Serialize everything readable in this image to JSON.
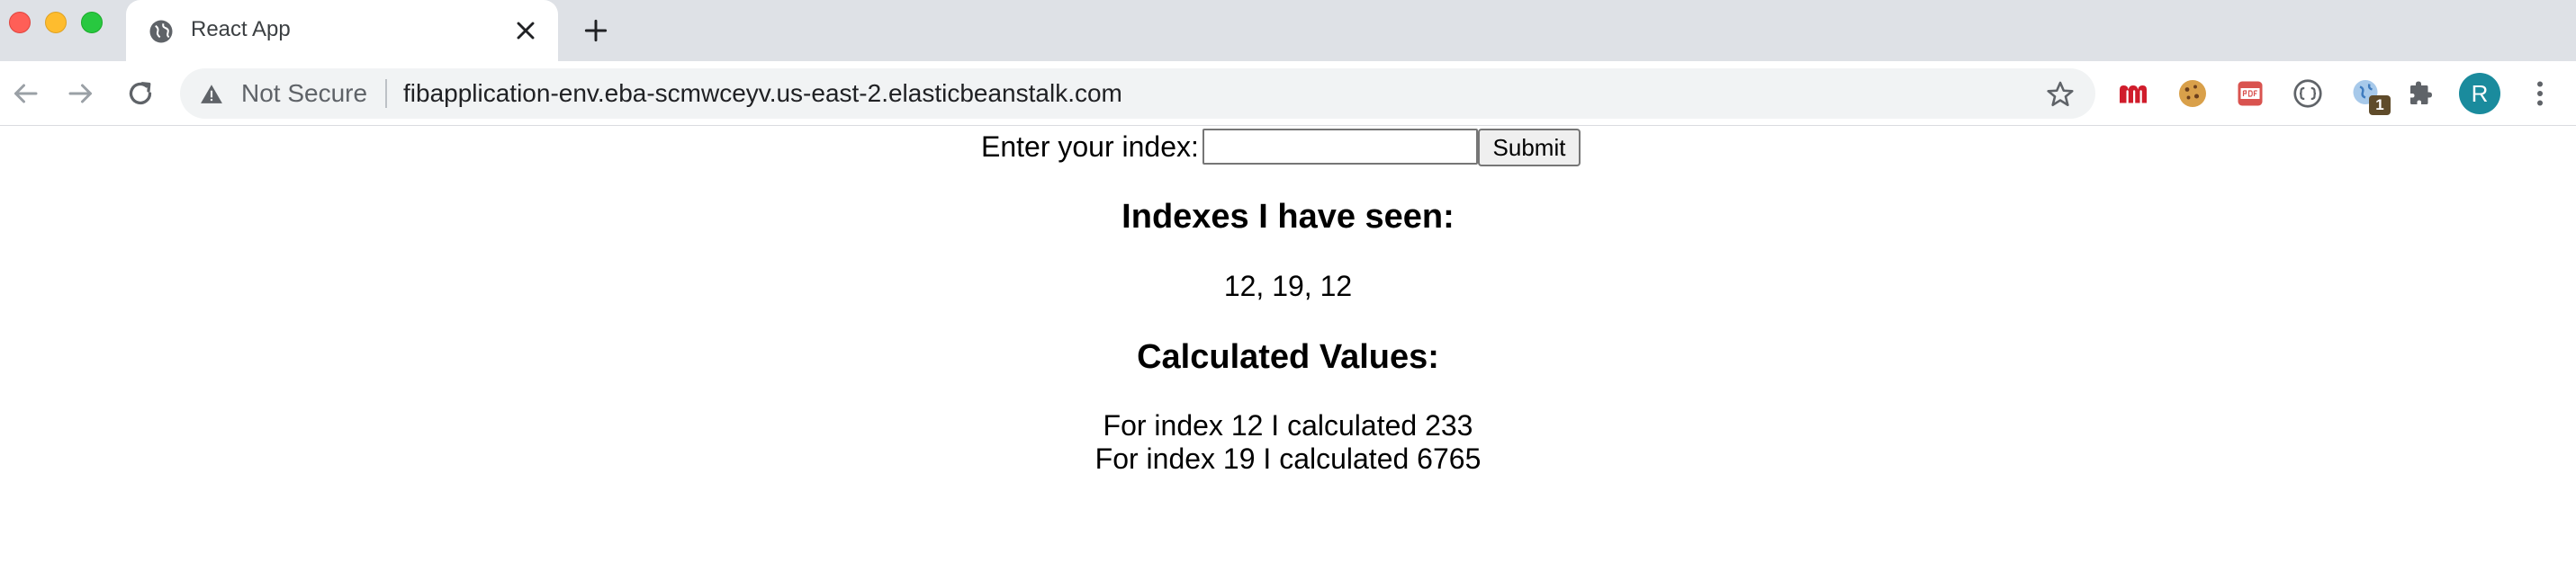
{
  "browser": {
    "tab": {
      "title": "React App"
    },
    "address": {
      "security_label": "Not Secure",
      "url": "fibapplication-env.eba-scmwceyv.us-east-2.elasticbeanstalk.com"
    },
    "extension_badge": "1",
    "avatar_initial": "R",
    "icons": [
      "globe-icon",
      "close-icon",
      "plus-icon",
      "back-arrow-icon",
      "forward-arrow-icon",
      "reload-icon",
      "warning-icon",
      "star-icon",
      "m-extension-icon",
      "cookie-icon",
      "pdf-icon",
      "code-icon",
      "translate-globe-icon",
      "puzzle-icon",
      "kebab-menu-icon"
    ],
    "colors": {
      "tabstrip": "#dee1e6",
      "avatar": "#1a8b9d",
      "m_extension": "#d01c2b"
    }
  },
  "page": {
    "form": {
      "label": "Enter your index:",
      "input_value": "",
      "submit_label": "Submit"
    },
    "seen_heading": "Indexes I have seen:",
    "seen_indexes": "12, 19, 12",
    "calculated_heading": "Calculated Values:",
    "calculated_values": [
      "For index 12 I calculated 233",
      "For index 19 I calculated 6765"
    ]
  }
}
